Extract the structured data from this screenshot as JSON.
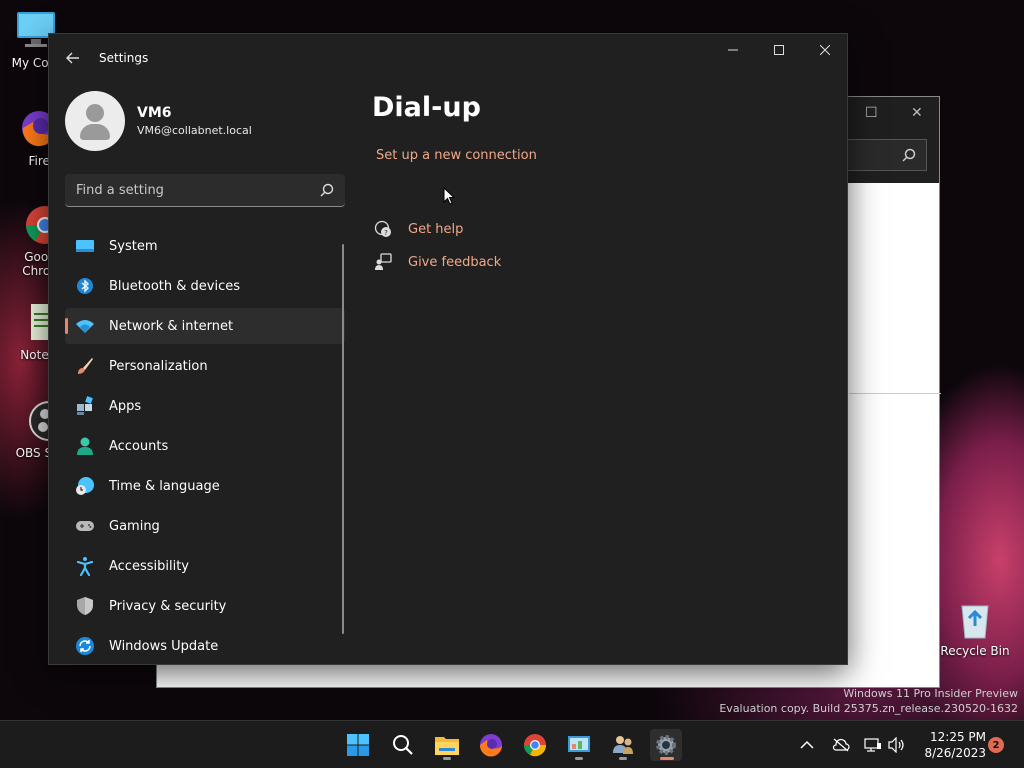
{
  "desktop": {
    "icons": [
      {
        "label": "My Com"
      },
      {
        "label": "Firefo"
      },
      {
        "label": "Goog Chron"
      },
      {
        "label": "Notepa"
      },
      {
        "label": "OBS Stu"
      },
      {
        "label": "Recycle Bin"
      }
    ],
    "watermark": {
      "line1": "Windows 11 Pro Insider Preview",
      "line2": "Evaluation copy. Build 25375.zn_release.230520-1632"
    }
  },
  "settings": {
    "app_title": "Settings",
    "user": {
      "name": "VM6",
      "email": "VM6@collabnet.local"
    },
    "search": {
      "placeholder": "Find a setting"
    },
    "nav": [
      {
        "label": "System",
        "icon": "monitor-icon"
      },
      {
        "label": "Bluetooth & devices",
        "icon": "bluetooth-icon"
      },
      {
        "label": "Network & internet",
        "icon": "wifi-icon",
        "selected": true
      },
      {
        "label": "Personalization",
        "icon": "brush-icon"
      },
      {
        "label": "Apps",
        "icon": "apps-icon"
      },
      {
        "label": "Accounts",
        "icon": "person-icon"
      },
      {
        "label": "Time & language",
        "icon": "globe-clock-icon"
      },
      {
        "label": "Gaming",
        "icon": "gamepad-icon"
      },
      {
        "label": "Accessibility",
        "icon": "accessibility-icon"
      },
      {
        "label": "Privacy & security",
        "icon": "shield-icon"
      },
      {
        "label": "Windows Update",
        "icon": "update-icon"
      }
    ],
    "page": {
      "title": "Dial-up",
      "setup_link": "Set up a new connection",
      "get_help": "Get help",
      "give_feedback": "Give feedback"
    }
  },
  "taskbar": {
    "time": "12:25 PM",
    "date": "8/26/2023",
    "notifications": "2"
  },
  "colors": {
    "accent": "#e8866a",
    "link": "#f0a88a",
    "window_bg": "#202020"
  }
}
